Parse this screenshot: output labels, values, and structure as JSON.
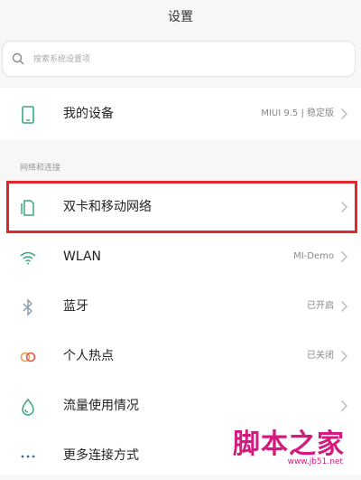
{
  "header": {
    "title": "设置"
  },
  "search": {
    "placeholder": "搜索系统设置项",
    "icon": "search-icon"
  },
  "device": {
    "label": "我的设备",
    "value": "MIUI 9.5 | 稳定版",
    "icon": "phone-icon"
  },
  "section": {
    "label": "网络和连接"
  },
  "items": [
    {
      "label": "双卡和移动网络",
      "value": "",
      "icon": "sim-card-icon",
      "highlighted": true
    },
    {
      "label": "WLAN",
      "value": "MI-Demo",
      "icon": "wifi-icon"
    },
    {
      "label": "蓝牙",
      "value": "已开启",
      "icon": "bluetooth-icon"
    },
    {
      "label": "个人热点",
      "value": "已关闭",
      "icon": "hotspot-icon"
    },
    {
      "label": "流量使用情况",
      "value": "",
      "icon": "data-usage-icon"
    },
    {
      "label": "更多连接方式",
      "value": "",
      "icon": "more-icon"
    }
  ],
  "watermark": {
    "text": "脚本之家",
    "url": "www.jb51.net"
  },
  "colors": {
    "highlight": "#e3262b",
    "watermark": "#d4197f",
    "icon_green": "#3aa77a"
  }
}
